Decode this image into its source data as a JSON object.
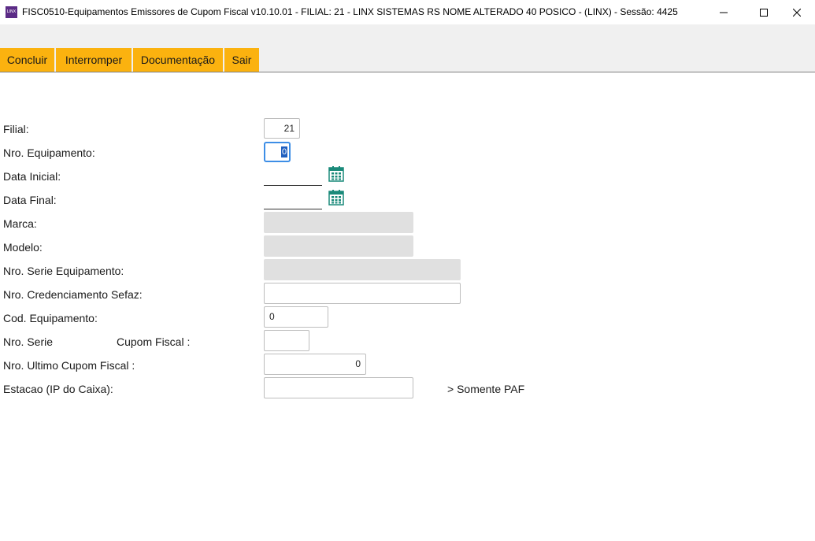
{
  "window": {
    "app_icon_text": "LINX",
    "title": "FISC0510-Equipamentos Emissores de Cupom Fiscal v10.10.01   - FILIAL: 21 - LINX SISTEMAS RS NOME ALTERADO 40 POSICO - (LINX) - Sessão: 4425"
  },
  "toolbar": {
    "concluir": "Concluir",
    "interromper": "Interromper",
    "documentacao": "Documentação",
    "sair": "Sair"
  },
  "colors": {
    "toolbar_button": "#fbb20f",
    "app_icon": "#5b2b86",
    "calendar_icon": "#1a8a7a",
    "focus": "#3d8ee6"
  },
  "form": {
    "filial": {
      "label": "Filial:",
      "value": "21"
    },
    "nro_equipamento": {
      "label": "Nro. Equipamento:",
      "value": "0"
    },
    "data_inicial": {
      "label": "Data Inicial:",
      "value": ""
    },
    "data_final": {
      "label": "Data Final:",
      "value": ""
    },
    "marca": {
      "label": "Marca:",
      "value": ""
    },
    "modelo": {
      "label": "Modelo:",
      "value": ""
    },
    "nro_serie_equipamento": {
      "label": "Nro. Serie Equipamento:",
      "value": ""
    },
    "nro_credenciamento": {
      "label": "Nro. Credenciamento Sefaz:",
      "value": ""
    },
    "cod_equipamento": {
      "label": "Cod. Equipamento:",
      "value": "0"
    },
    "nro_serie_cupom": {
      "label": "Nro. Serie",
      "label2": "Cupom Fiscal :",
      "value": ""
    },
    "nro_ultimo_cupom": {
      "label": "Nro. Ultimo Cupom Fiscal :",
      "value": "0"
    },
    "estacao": {
      "label": "Estacao (IP do Caixa):",
      "value": "",
      "note": "> Somente PAF"
    }
  }
}
